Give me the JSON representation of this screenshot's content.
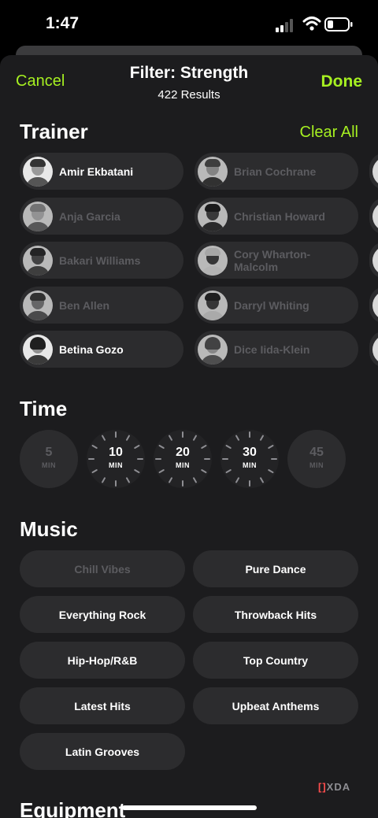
{
  "status_bar": {
    "time": "1:47"
  },
  "header": {
    "cancel_label": "Cancel",
    "title": "Filter: Strength",
    "subtitle": "422 Results",
    "done_label": "Done"
  },
  "trainer_section": {
    "title": "Trainer",
    "clear_all_label": "Clear All",
    "column1": [
      {
        "name": "Amir Ekbatani",
        "selected": true
      },
      {
        "name": "Anja Garcia",
        "selected": false
      },
      {
        "name": "Bakari Williams",
        "selected": false
      },
      {
        "name": "Ben Allen",
        "selected": false
      },
      {
        "name": "Betina Gozo",
        "selected": true
      }
    ],
    "column2": [
      {
        "name": "Brian Cochrane",
        "selected": false
      },
      {
        "name": "Christian Howard",
        "selected": false
      },
      {
        "name": "Cory Wharton-Malcolm",
        "line1": "Cory Wharton-",
        "line2": "Malcolm",
        "selected": false
      },
      {
        "name": "Darryl Whiting",
        "selected": false
      },
      {
        "name": "Dice Iida-Klein",
        "selected": false
      }
    ]
  },
  "time_section": {
    "title": "Time",
    "unit": "MIN",
    "options": [
      {
        "value": "5",
        "selected": false
      },
      {
        "value": "10",
        "selected": true
      },
      {
        "value": "20",
        "selected": true
      },
      {
        "value": "30",
        "selected": true
      },
      {
        "value": "45",
        "selected": false
      }
    ]
  },
  "music_section": {
    "title": "Music",
    "options": [
      {
        "label": "Chill Vibes",
        "selected": false
      },
      {
        "label": "Pure Dance",
        "selected": true
      },
      {
        "label": "Everything Rock",
        "selected": true
      },
      {
        "label": "Throwback Hits",
        "selected": true
      },
      {
        "label": "Hip-Hop/R&B",
        "selected": true
      },
      {
        "label": "Top Country",
        "selected": true
      },
      {
        "label": "Latest Hits",
        "selected": true
      },
      {
        "label": "Upbeat Anthems",
        "selected": true
      },
      {
        "label": "Latin Grooves",
        "selected": true
      }
    ]
  },
  "equipment_section": {
    "title": "Equipment"
  },
  "watermark": {
    "brand": "XDA"
  },
  "colors": {
    "accent": "#a6f021",
    "sheet_bg": "#1c1c1e",
    "chip_bg": "#2c2c2e",
    "muted_text": "#5c5c60"
  }
}
